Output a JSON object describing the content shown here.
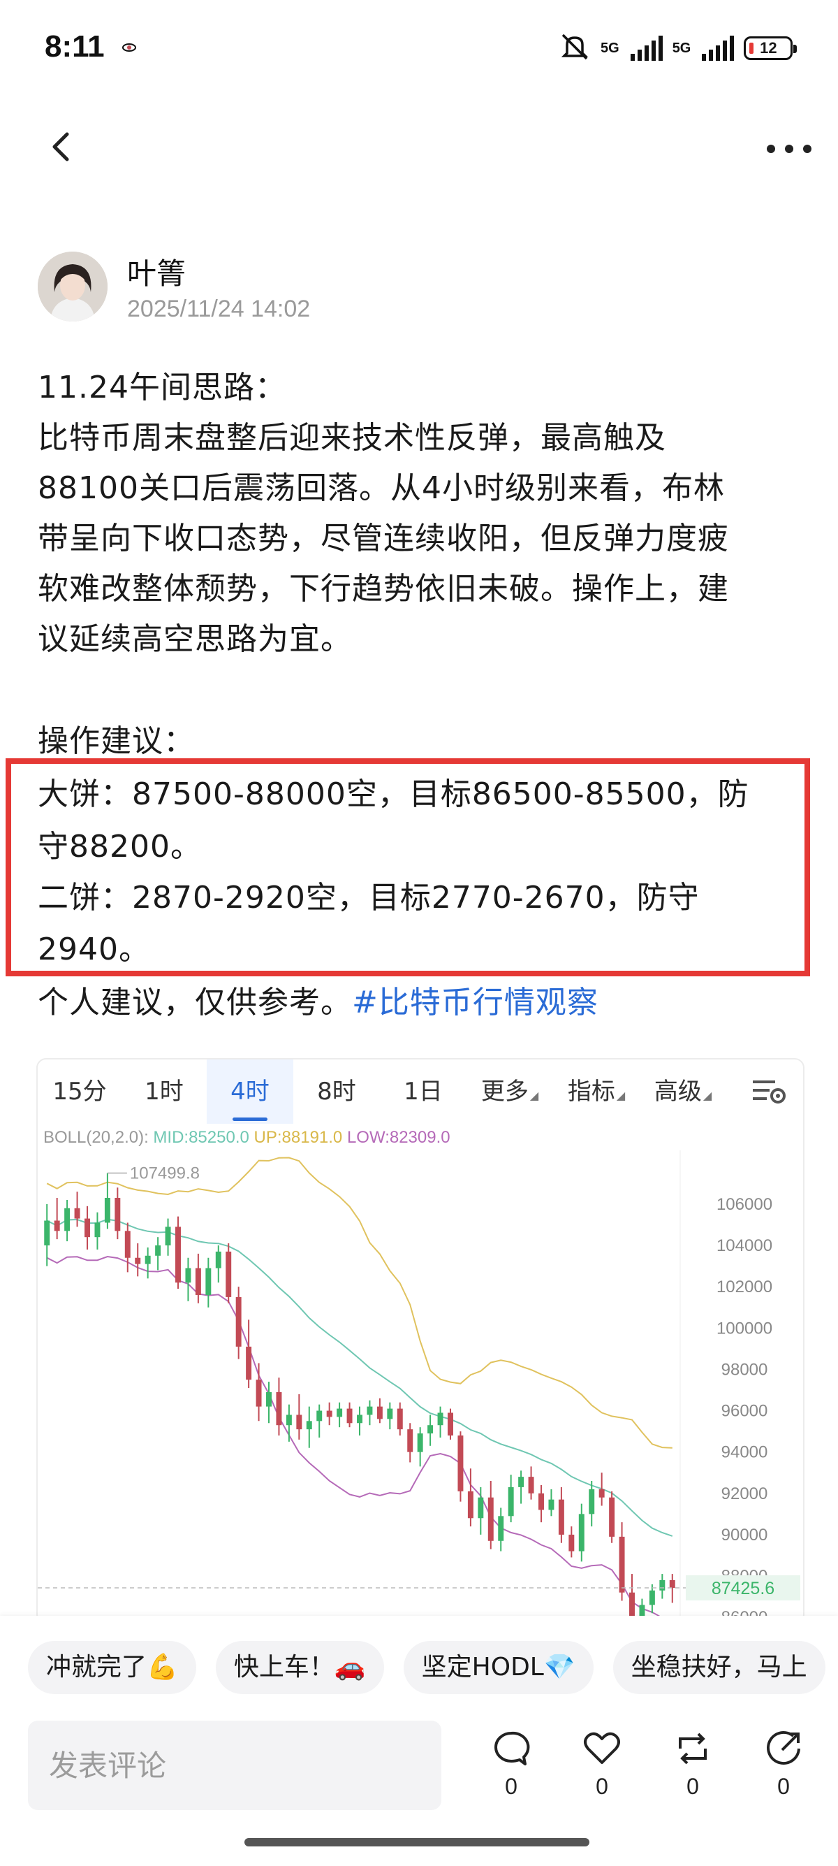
{
  "status_bar": {
    "time": "8:11",
    "network1": "5G",
    "network2": "5G",
    "battery": "12"
  },
  "nav": {
    "back_icon": "chevron-left-icon",
    "more_icon": "more-dots-icon"
  },
  "author": {
    "name": "叶箐",
    "date": "2025/11/24 14:02"
  },
  "post": {
    "lines": [
      "11.24午间思路：",
      "比特币周末盘整后迎来技术性反弹，最高触及",
      "88100关口后震荡回落。从4小时级别来看，布林",
      "带呈向下收口态势，尽管连续收阳，但反弹力度疲",
      "软难改整体颓势，下行趋势依旧未破。操作上，建",
      "议延续高空思路为宜。",
      "",
      "操作建议：",
      "大饼：87500-88000空，目标86500-85500，防",
      "守88200。",
      "二饼：2870-2920空，目标2770-2670，防守",
      "2940。"
    ],
    "closing": "个人建议，仅供参考。",
    "hashtag": "#比特币行情观察"
  },
  "chart": {
    "tabs": [
      "15分",
      "1时",
      "4时",
      "8时",
      "1日",
      "更多",
      "指标",
      "高级"
    ],
    "active_tab": "4时",
    "boll": {
      "label": "BOLL(20,2.0):",
      "mid": "MID:85250.0",
      "up": "UP:88191.0",
      "low": "LOW:82309.0"
    },
    "high_marker": "107499.8",
    "current_price": "87425.6",
    "y_labels": [
      "106000",
      "104000",
      "102000",
      "100000",
      "98000",
      "96000",
      "94000",
      "92000",
      "90000",
      "88000",
      "86000"
    ],
    "colors": {
      "up": "#3bb56a",
      "down": "#c24a55",
      "mid": "#6fc7b2",
      "upper": "#e0c25e",
      "lower": "#b56ab8",
      "accent": "#2a6bd6"
    }
  },
  "chart_data": {
    "type": "candlestick",
    "title": "",
    "indicator": "BOLL(20,2.0)",
    "ylim": [
      85600,
      108600
    ],
    "y_ticks": [
      106000,
      104000,
      102000,
      100000,
      98000,
      96000,
      94000,
      92000,
      90000,
      88000,
      86000
    ],
    "ohlc": [
      [
        104000,
        106000,
        103000,
        105200
      ],
      [
        105200,
        106300,
        104300,
        104700
      ],
      [
        104700,
        106200,
        104200,
        105800
      ],
      [
        105800,
        106600,
        104900,
        105300
      ],
      [
        105300,
        105900,
        103800,
        104400
      ],
      [
        104400,
        105600,
        103800,
        105100
      ],
      [
        105100,
        107499.8,
        104800,
        106300
      ],
      [
        106300,
        106800,
        104300,
        104700
      ],
      [
        104700,
        105100,
        102700,
        103400
      ],
      [
        103400,
        104100,
        102500,
        103100
      ],
      [
        103100,
        103900,
        102400,
        103500
      ],
      [
        103500,
        104400,
        102800,
        104000
      ],
      [
        104000,
        105300,
        103500,
        104900
      ],
      [
        104900,
        105400,
        101900,
        102200
      ],
      [
        102200,
        103400,
        101300,
        102900
      ],
      [
        102900,
        103600,
        101200,
        101600
      ],
      [
        101600,
        103400,
        101000,
        102900
      ],
      [
        102900,
        104000,
        102200,
        103700
      ],
      [
        103700,
        104100,
        101200,
        101500
      ],
      [
        101500,
        102000,
        98500,
        99100
      ],
      [
        99100,
        100400,
        97100,
        97500
      ],
      [
        97500,
        98300,
        95500,
        96200
      ],
      [
        96200,
        97400,
        95400,
        96900
      ],
      [
        96900,
        97600,
        94800,
        95300
      ],
      [
        95300,
        96300,
        94500,
        95800
      ],
      [
        95800,
        96800,
        94600,
        95100
      ],
      [
        95100,
        96200,
        94200,
        95500
      ],
      [
        95500,
        96300,
        94700,
        96000
      ],
      [
        96000,
        96400,
        95300,
        95700
      ],
      [
        95700,
        96400,
        95200,
        96100
      ],
      [
        96100,
        96400,
        95200,
        95400
      ],
      [
        95400,
        96200,
        94800,
        95800
      ],
      [
        95800,
        96500,
        95300,
        96200
      ],
      [
        96200,
        96600,
        95400,
        95600
      ],
      [
        95600,
        96400,
        95100,
        96100
      ],
      [
        96100,
        96400,
        94800,
        95100
      ],
      [
        95100,
        95400,
        93500,
        94000
      ],
      [
        94000,
        95200,
        93300,
        94900
      ],
      [
        94900,
        95800,
        94300,
        95300
      ],
      [
        95300,
        96200,
        94700,
        95900
      ],
      [
        95900,
        96100,
        94600,
        94800
      ],
      [
        94800,
        95000,
        91600,
        92100
      ],
      [
        92100,
        93200,
        90400,
        90800
      ],
      [
        90800,
        92300,
        90000,
        91800
      ],
      [
        91800,
        92600,
        89300,
        89700
      ],
      [
        89700,
        91300,
        89200,
        90900
      ],
      [
        90900,
        92900,
        90600,
        92300
      ],
      [
        92300,
        93100,
        91500,
        92800
      ],
      [
        92800,
        93300,
        91700,
        92000
      ],
      [
        92000,
        92400,
        90600,
        91200
      ],
      [
        91200,
        92200,
        90900,
        91700
      ],
      [
        91700,
        92300,
        89600,
        90000
      ],
      [
        90000,
        90400,
        88900,
        89200
      ],
      [
        89200,
        91500,
        88700,
        91000
      ],
      [
        91000,
        92600,
        90400,
        92200
      ],
      [
        92200,
        93000,
        91400,
        91800
      ],
      [
        91800,
        92100,
        89600,
        89900
      ],
      [
        89900,
        90600,
        86800,
        87200
      ],
      [
        87200,
        88100,
        85600,
        85800
      ],
      [
        86000,
        86900,
        85700,
        86600
      ],
      [
        86600,
        87600,
        86200,
        87300
      ],
      [
        87300,
        88100,
        86900,
        87800
      ],
      [
        87800,
        88100,
        86700,
        87425.6
      ]
    ],
    "current_price": 87425.6,
    "high_annotation": 107499.8
  },
  "quick_replies": [
    "冲就完了💪",
    "快上车！🚗",
    "坚定HODL💎",
    "坐稳扶好，马上"
  ],
  "comment": {
    "placeholder": "发表评论"
  },
  "actions": [
    {
      "icon": "comment-icon",
      "count": "0"
    },
    {
      "icon": "heart-icon",
      "count": "0"
    },
    {
      "icon": "repost-icon",
      "count": "0"
    },
    {
      "icon": "share-icon",
      "count": "0"
    }
  ]
}
